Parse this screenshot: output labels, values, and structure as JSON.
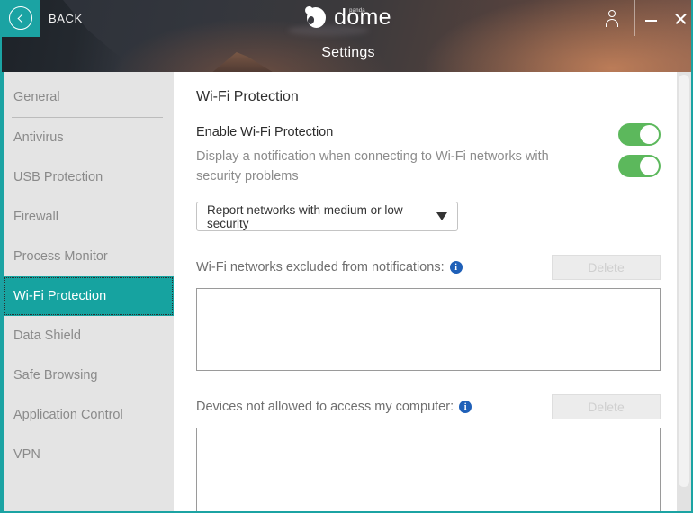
{
  "window": {
    "accent_color": "#1BA3A3",
    "back_label": "BACK",
    "brand_name": "dome",
    "brand_sup": "panda",
    "page_header": "Settings",
    "icons": {
      "back": "chevron-left-icon",
      "user": "user-account-icon",
      "minimize": "minimize-icon",
      "close": "close-icon"
    }
  },
  "sidebar": {
    "items": [
      {
        "label": "General",
        "selected": false
      },
      {
        "label": "Antivirus",
        "selected": false
      },
      {
        "label": "USB Protection",
        "selected": false
      },
      {
        "label": "Firewall",
        "selected": false
      },
      {
        "label": "Process Monitor",
        "selected": false
      },
      {
        "label": "Wi-Fi Protection",
        "selected": true
      },
      {
        "label": "Data Shield",
        "selected": false
      },
      {
        "label": "Safe Browsing",
        "selected": false
      },
      {
        "label": "Application Control",
        "selected": false
      },
      {
        "label": "VPN",
        "selected": false
      }
    ]
  },
  "content": {
    "title": "Wi-Fi Protection",
    "enable": {
      "label": "Enable Wi-Fi Protection",
      "toggle_state": "on",
      "toggle_color": "#5cb85c"
    },
    "notify": {
      "label": "Display a notification when connecting to Wi-Fi networks with security problems",
      "toggle_state": "on",
      "toggle_color": "#5cb85c"
    },
    "severity_dropdown": {
      "value": "Report networks with medium or low security",
      "caret": "chevron-down-icon"
    },
    "excluded_networks": {
      "label": "Wi-Fi networks excluded from notifications:",
      "info_icon": "info-icon",
      "delete_label": "Delete",
      "delete_enabled": false,
      "items": []
    },
    "blocked_devices": {
      "label": "Devices not allowed to access my computer:",
      "info_icon": "info-icon",
      "delete_label": "Delete",
      "delete_enabled": false,
      "items": []
    }
  }
}
